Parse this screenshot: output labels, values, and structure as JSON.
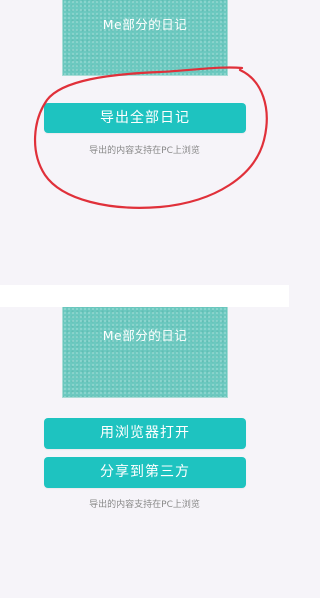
{
  "top_screen": {
    "cover_title": "Me部分的日记",
    "export_button_label": "导出全部日记",
    "hint": "导出的内容支持在PC上浏览"
  },
  "bottom_screen": {
    "cover_title": "Me部分的日记",
    "open_in_browser_label": "用浏览器打开",
    "share_label": "分享到第三方",
    "hint": "导出的内容支持在PC上浏览"
  },
  "colors": {
    "background": "#f6f4f9",
    "accent_button": "#1ec3c0",
    "cover": "#6cc9c0",
    "annotation_circle": "#e0303a"
  }
}
